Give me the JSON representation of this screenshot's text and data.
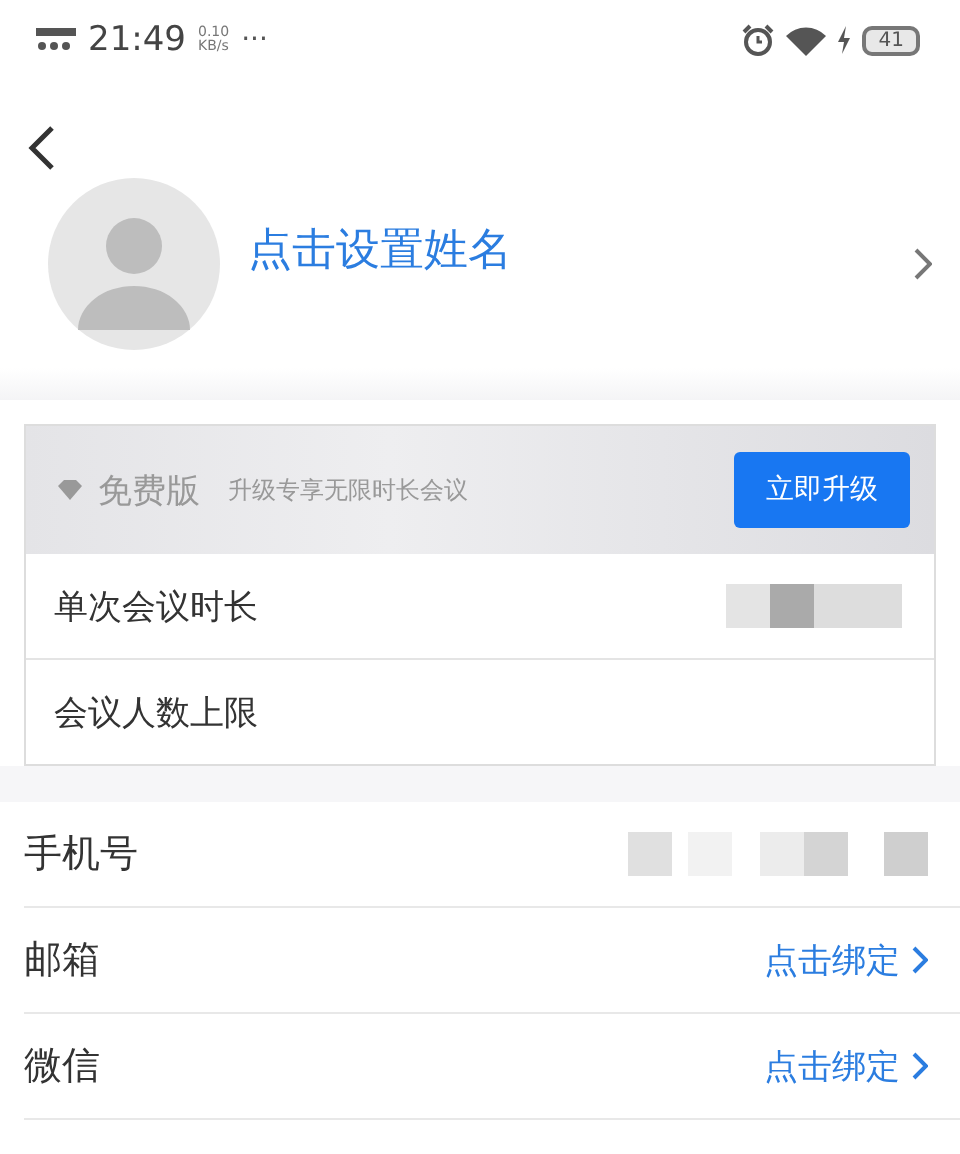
{
  "status_bar": {
    "time": "21:49",
    "speed": "0.10",
    "speed_unit": "KB/s",
    "more": "···",
    "battery": "41"
  },
  "profile": {
    "name": "点击设置姓名"
  },
  "plan": {
    "badge": "免费版",
    "hint": "升级专享无限时长会议",
    "button": "立即升级"
  },
  "plan_rows": [
    {
      "label": "单次会议时长",
      "masked": true
    },
    {
      "label": "会议人数上限",
      "masked": false
    }
  ],
  "account_rows": [
    {
      "label": "手机号",
      "kind": "masked"
    },
    {
      "label": "邮箱",
      "kind": "link",
      "value": "点击绑定"
    },
    {
      "label": "微信",
      "kind": "link",
      "value": "点击绑定"
    }
  ]
}
